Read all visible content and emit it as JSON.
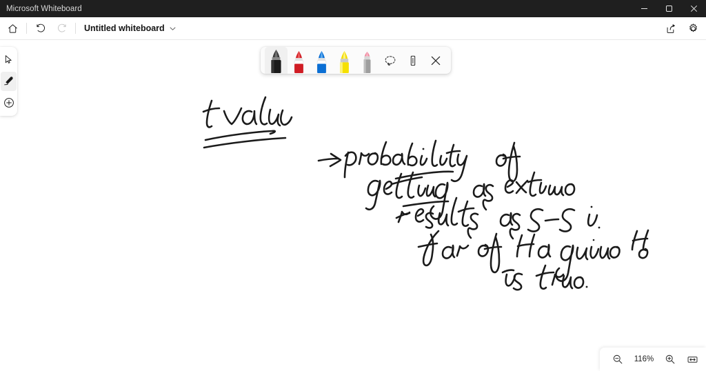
{
  "window": {
    "app_title": "Microsoft Whiteboard",
    "controls": [
      {
        "name": "minimize",
        "label": "Minimize",
        "glyph": "minimize-icon"
      },
      {
        "name": "maximize",
        "label": "Restore",
        "glyph": "maximize-icon"
      },
      {
        "name": "close",
        "label": "Close",
        "glyph": "close-icon"
      }
    ]
  },
  "command_bar": {
    "home_label": "Home",
    "undo_label": "Undo",
    "redo_label": "Redo",
    "redo_disabled": true,
    "document_title": "Untitled whiteboard",
    "title_chevron": "chevron-down-icon",
    "share_label": "Share",
    "settings_label": "Settings"
  },
  "left_rail": {
    "items": [
      {
        "name": "select-tool",
        "label": "Select",
        "icon": "cursor-arrow-icon",
        "selected": false
      },
      {
        "name": "pen-tool",
        "label": "Inking",
        "icon": "pen-icon",
        "selected": true
      },
      {
        "name": "create-tool",
        "label": "Create",
        "icon": "plus-circle-icon",
        "selected": false
      }
    ]
  },
  "pen_toolbar": {
    "pens": [
      {
        "name": "pen-black",
        "label": "Black pen",
        "color": "#1a1a1a",
        "selected": true
      },
      {
        "name": "pen-red",
        "label": "Red pen",
        "color": "#e01b24",
        "selected": false
      },
      {
        "name": "pen-blue",
        "label": "Blue pen",
        "color": "#0b6fd4",
        "selected": false
      },
      {
        "name": "highlighter-yellow",
        "label": "Yellow highlighter",
        "color": "#f5e000",
        "selected": false
      },
      {
        "name": "eraser",
        "label": "Eraser",
        "color": "#f5a3b5",
        "selected": false
      }
    ],
    "tools": [
      {
        "name": "lasso-select",
        "label": "Lasso select",
        "icon": "lasso-icon"
      },
      {
        "name": "ruler",
        "label": "Ruler",
        "icon": "ruler-icon"
      },
      {
        "name": "close-toolbar",
        "label": "Close",
        "icon": "close-icon"
      }
    ]
  },
  "canvas": {
    "background_color": "#ffffff",
    "ink_color": "#1b1b1b",
    "notes": [
      {
        "name": "ink-line-1",
        "text": "t-value   ->  probability  of"
      },
      {
        "name": "ink-line-2",
        "text": "getting   as extreme"
      },
      {
        "name": "ink-line-3",
        "text": "results  as S-S  is"
      },
      {
        "name": "ink-line-4",
        "text": "far of Ha given H0"
      },
      {
        "name": "ink-line-5",
        "text": "is true"
      }
    ],
    "transcript": "t-value -> probability of getting as extreme results as S-S is far of Ha given H0 is true"
  },
  "zoom_controls": {
    "zoom_out_label": "Zoom out",
    "zoom_level": "116%",
    "zoom_in_label": "Zoom in",
    "fit_label": "Fit to screen"
  }
}
